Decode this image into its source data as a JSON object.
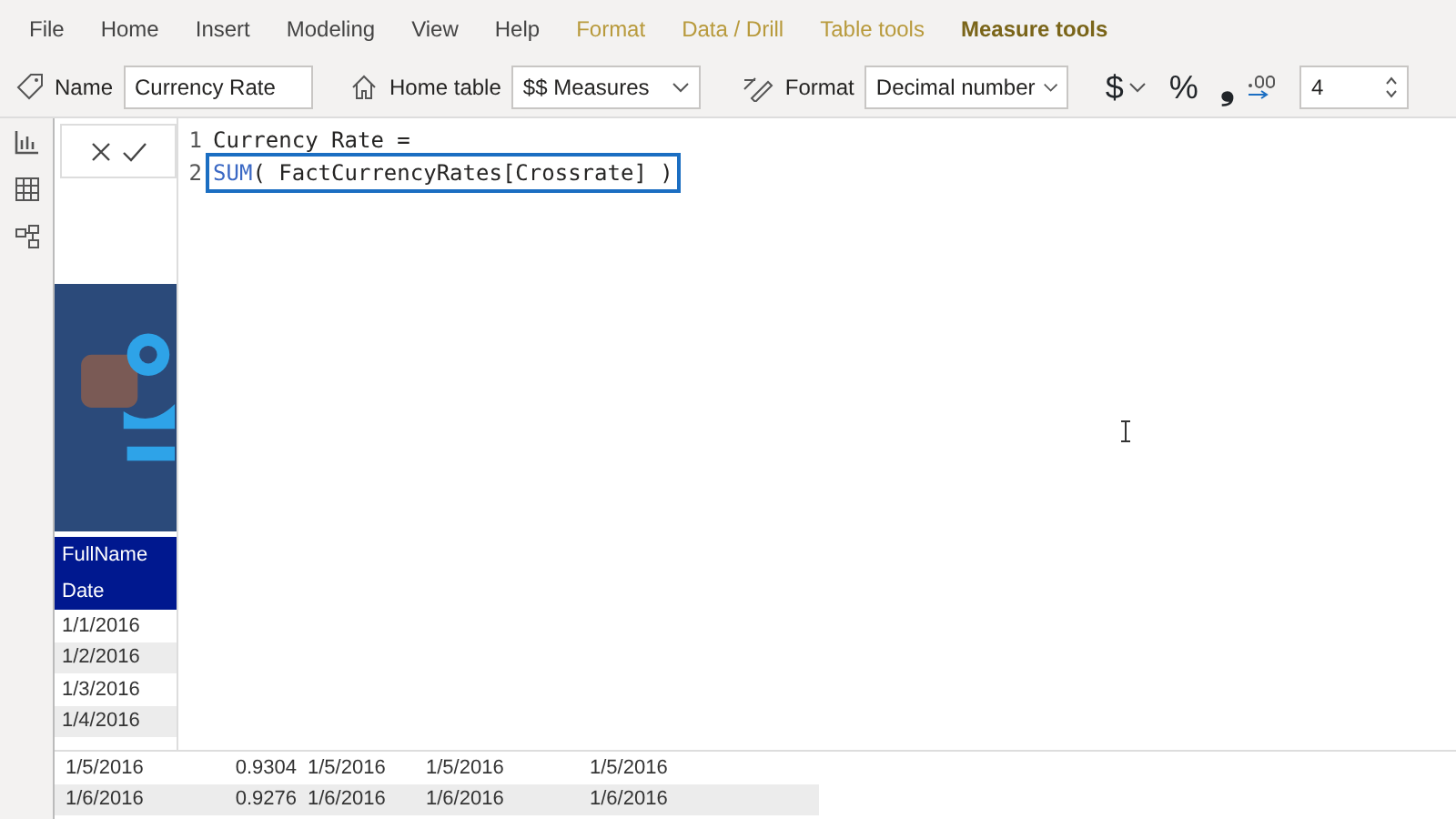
{
  "ribbon_tabs": [
    {
      "label": "File",
      "kind": "standard",
      "selected": false
    },
    {
      "label": "Home",
      "kind": "standard",
      "selected": false
    },
    {
      "label": "Insert",
      "kind": "standard",
      "selected": false
    },
    {
      "label": "Modeling",
      "kind": "standard",
      "selected": false
    },
    {
      "label": "View",
      "kind": "standard",
      "selected": false
    },
    {
      "label": "Help",
      "kind": "standard",
      "selected": false
    },
    {
      "label": "Format",
      "kind": "contextual",
      "selected": false
    },
    {
      "label": "Data / Drill",
      "kind": "contextual",
      "selected": false
    },
    {
      "label": "Table tools",
      "kind": "contextual",
      "selected": false
    },
    {
      "label": "Measure tools",
      "kind": "contextual",
      "selected": true
    }
  ],
  "toolbar": {
    "name_label": "Name",
    "name_value": "Currency Rate",
    "home_table_label": "Home table",
    "home_table_value": "$$ Measures",
    "format_label": "Format",
    "format_value": "Decimal number",
    "currency_symbol": "$",
    "percent_symbol": "%",
    "comma_symbol": "❟",
    "decimal_places": "4"
  },
  "formula_editor": {
    "lines": [
      {
        "number": "1",
        "tokens": [
          {
            "text": "Currency Rate =",
            "kind": "plain"
          }
        ],
        "selected": false
      },
      {
        "number": "2",
        "tokens": [
          {
            "text": "SUM",
            "kind": "function"
          },
          {
            "text": "( FactCurrencyRates[Crossrate] )",
            "kind": "plain"
          }
        ],
        "selected": true
      }
    ]
  },
  "table": {
    "header_rows": [
      "FullName",
      "Date"
    ],
    "rows_behind_editor": [
      "1/1/2016",
      "1/2/2016",
      "1/3/2016",
      "1/4/2016"
    ],
    "rows": [
      [
        "1/5/2016",
        "0.9304",
        "1/5/2016",
        "1/5/2016",
        "1/5/2016"
      ],
      [
        "1/6/2016",
        "0.9276",
        "1/6/2016",
        "1/6/2016",
        "1/6/2016"
      ]
    ]
  }
}
